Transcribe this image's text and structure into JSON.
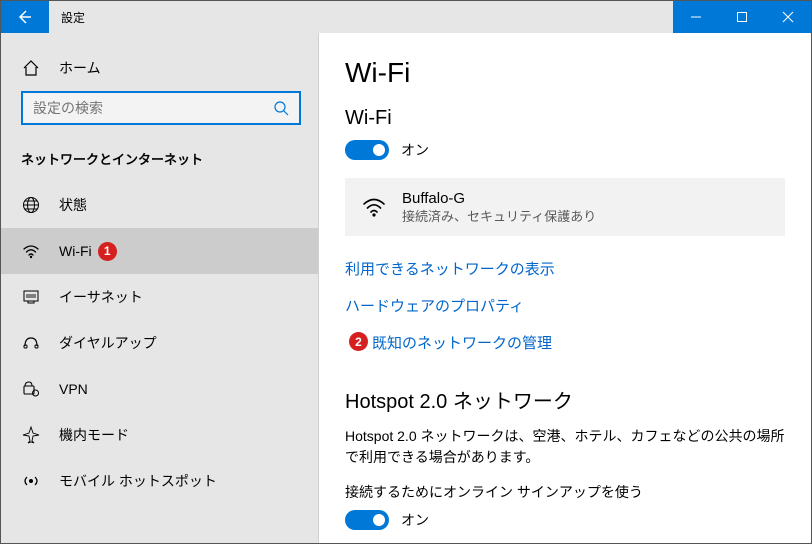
{
  "titlebar": {
    "title": "設定"
  },
  "sidebar": {
    "home": "ホーム",
    "search_placeholder": "設定の検索",
    "category": "ネットワークとインターネット",
    "items": [
      {
        "label": "状態"
      },
      {
        "label": "Wi-Fi",
        "badge": "1"
      },
      {
        "label": "イーサネット"
      },
      {
        "label": "ダイヤルアップ"
      },
      {
        "label": "VPN"
      },
      {
        "label": "機内モード"
      },
      {
        "label": "モバイル ホットスポット"
      }
    ]
  },
  "content": {
    "page_title": "Wi-Fi",
    "wifi_section_title": "Wi-Fi",
    "wifi_toggle_label": "オン",
    "network": {
      "name": "Buffalo-G",
      "status": "接続済み、セキュリティ保護あり"
    },
    "link_show_networks": "利用できるネットワークの表示",
    "link_hw_props": "ハードウェアのプロパティ",
    "link_known_networks": "既知のネットワークの管理",
    "known_badge": "2",
    "hotspot_title": "Hotspot 2.0 ネットワーク",
    "hotspot_desc": "Hotspot 2.0 ネットワークは、空港、ホテル、カフェなどの公共の場所で利用できる場合があります。",
    "hotspot_toggle_title": "接続するためにオンライン サインアップを使う",
    "hotspot_toggle_label": "オン"
  }
}
